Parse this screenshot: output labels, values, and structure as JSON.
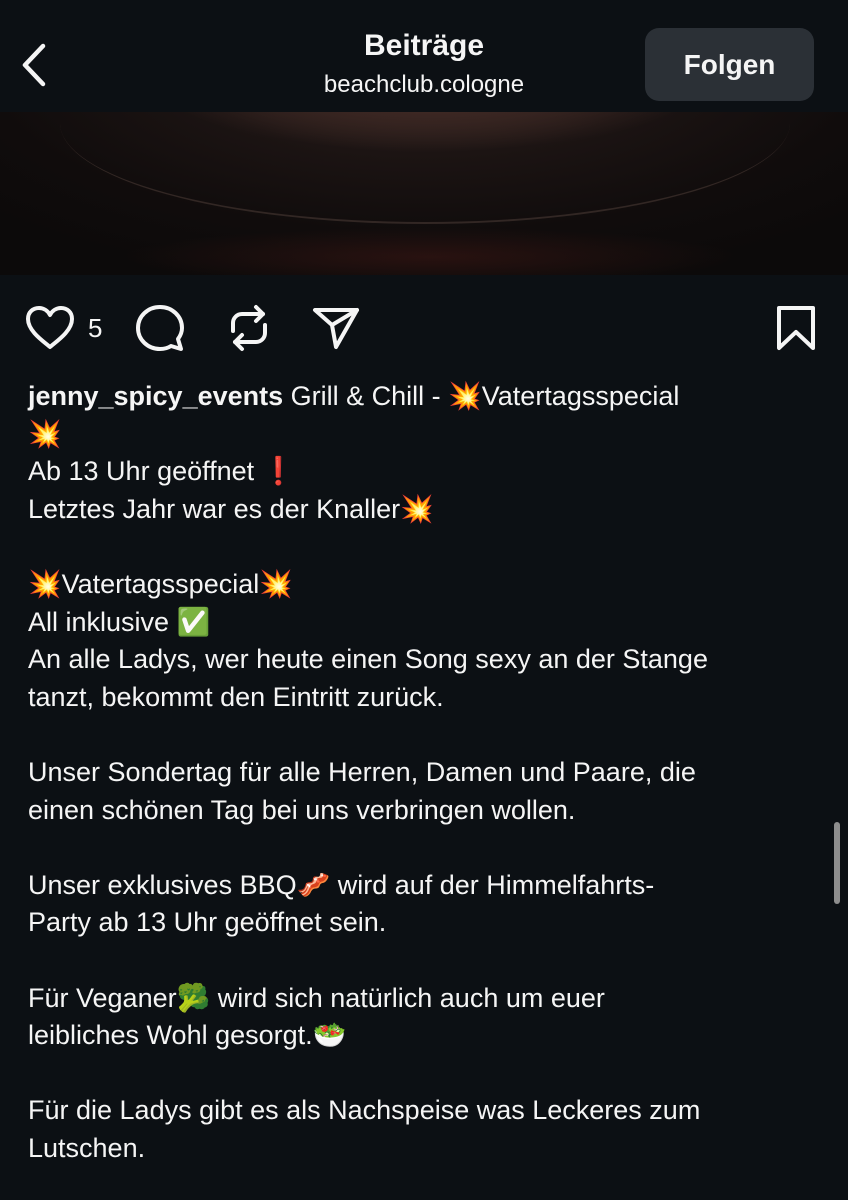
{
  "header": {
    "title": "Beiträge",
    "subtitle": "beachclub.cologne",
    "follow_label": "Folgen"
  },
  "icons": {
    "back": "chevron-left-icon",
    "like": "heart-outline-icon",
    "comment": "comment-bubble-icon",
    "repost": "repost-arrows-icon",
    "share": "paper-plane-icon",
    "save": "bookmark-outline-icon"
  },
  "actions": {
    "like_count": "5"
  },
  "post": {
    "username": "jenny_spicy_events",
    "caption_lines": [
      " Grill & Chill - 💥Vatertagsspecial",
      "💥",
      "Ab 13 Uhr geöffnet ❗",
      "Letztes Jahr war es der Knaller💥",
      "",
      "💥Vatertagsspecial💥",
      "All inklusive ✅",
      "An alle Ladys, wer heute einen Song sexy an der Stange",
      "tanzt, bekommt den Eintritt zurück.",
      "",
      "Unser Sondertag für alle Herren, Damen und Paare, die",
      "einen schönen Tag bei uns verbringen wollen.",
      "",
      "Unser exklusives BBQ🥓 wird auf der Himmelfahrts-",
      "Party ab 13 Uhr geöffnet sein.",
      "",
      "Für Veganer🥦 wird sich natürlich auch um euer",
      "leibliches Wohl gesorgt.🥗",
      "",
      "Für die Ladys gibt es als Nachspeise was Leckeres zum",
      "Lutschen."
    ]
  },
  "colors": {
    "background": "#0c1014",
    "text": "#f5f5f5",
    "button_bg": "#2b3036",
    "scrollbar": "#8e8e8e"
  }
}
